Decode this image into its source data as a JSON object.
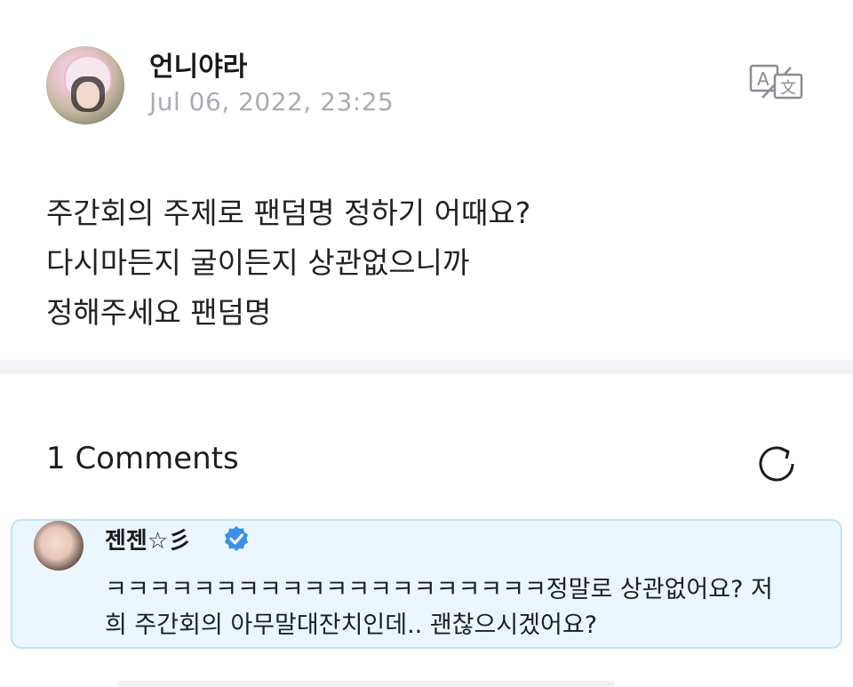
{
  "post": {
    "author": "언니야라",
    "timestamp": "Jul 06, 2022, 23:25",
    "body_lines": [
      "주간회의 주제로 팬덤명 정하기 어때요?",
      "다시마든지 굴이든지 상관없으니까",
      "정해주세요 팬덤명"
    ],
    "translate_icon": "translate-icon"
  },
  "comments": {
    "title": "1 Comments",
    "refresh_icon": "refresh-icon",
    "items": [
      {
        "author": "젠젠☆彡",
        "verified": true,
        "text_lines": [
          "ㅋㅋㅋㅋㅋㅋㅋㅋㅋㅋㅋㅋㅋㅋㅋㅋㅋㅋㅋㅋ정말로 상관없어요? 저",
          "희 주간회의 아무말대잔치인데.. 괜찮으시겠어요?"
        ]
      }
    ]
  },
  "colors": {
    "timestamp": "#a9acb3",
    "divider": "#f2f3f6",
    "comment_bg": "#eaf6fb",
    "comment_border": "#bfe3f2",
    "verified": "#3d8fe6"
  }
}
